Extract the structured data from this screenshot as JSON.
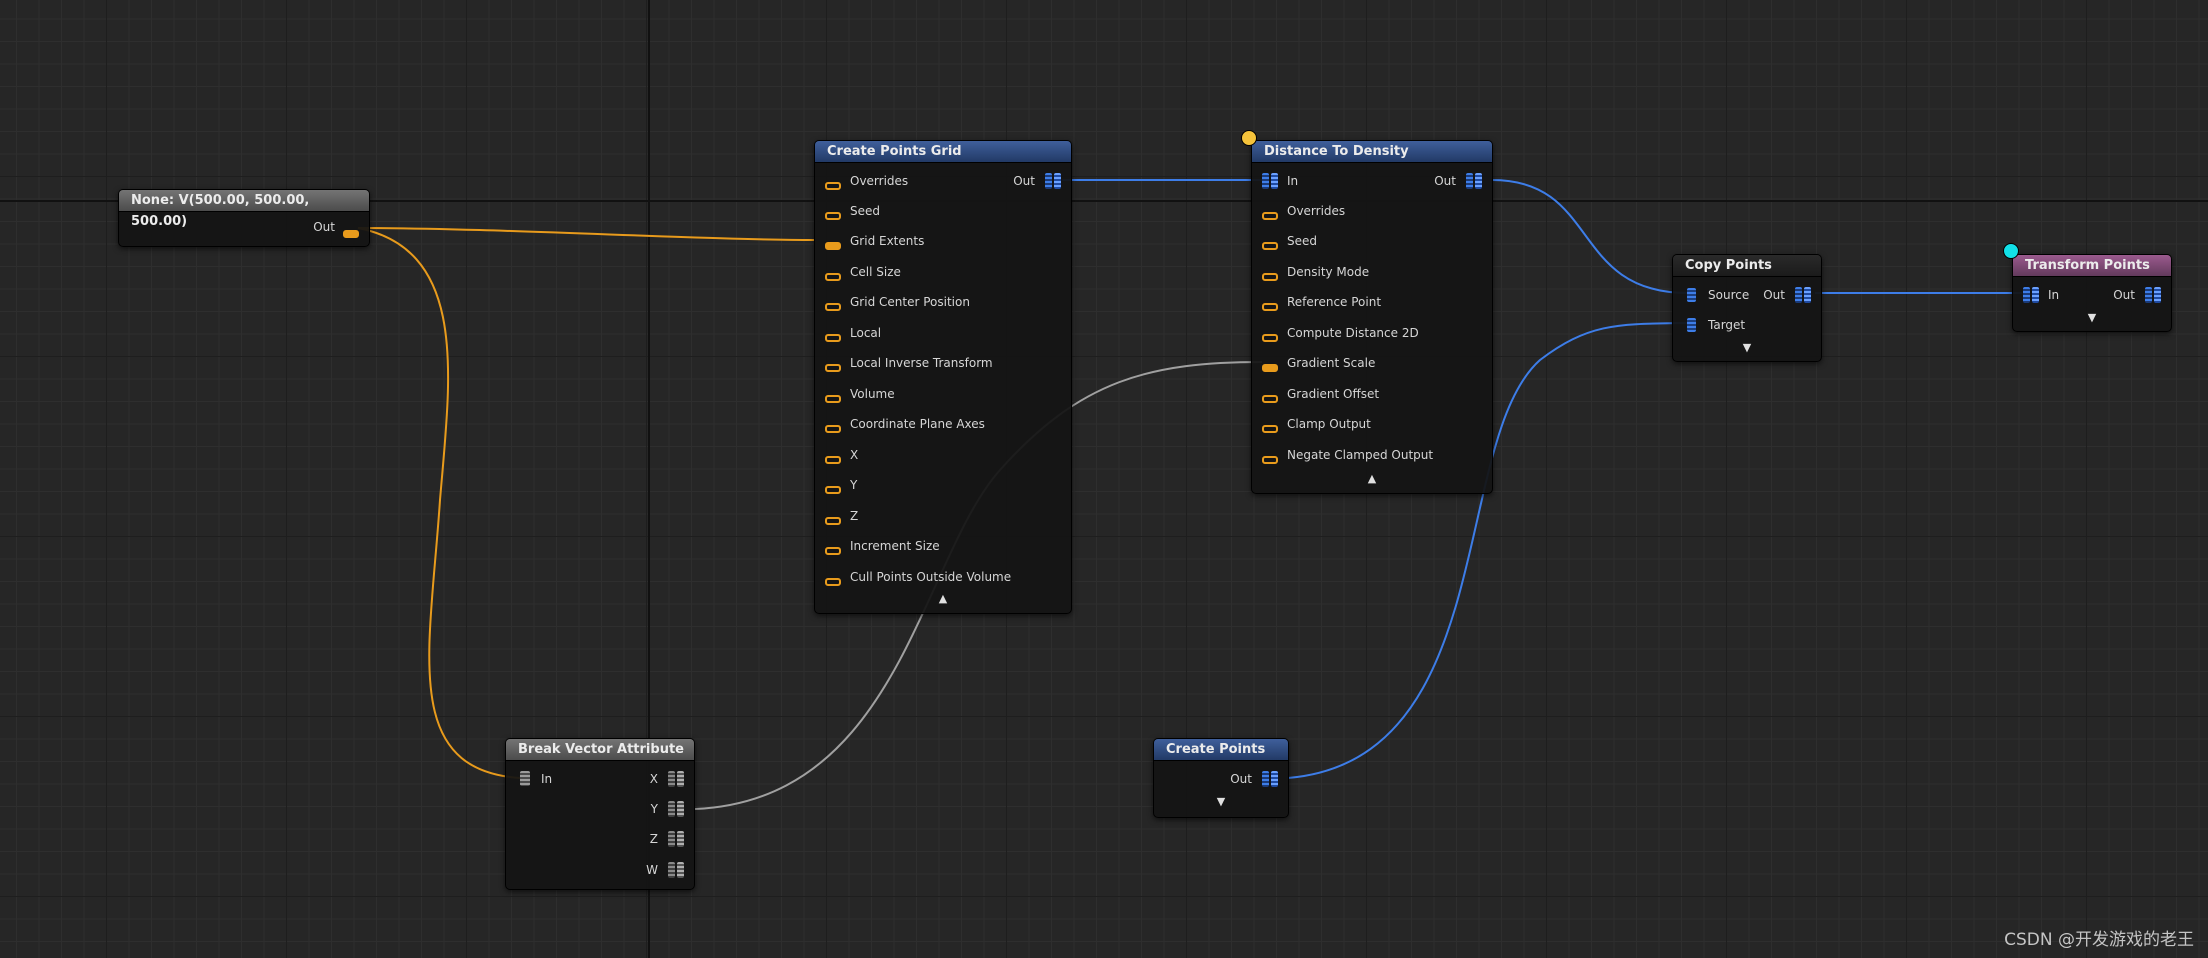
{
  "nodes": {
    "constant": {
      "title": "None: V(500.00, 500.00, 500.00)",
      "out_label": "Out"
    },
    "create_points_grid": {
      "title": "Create Points Grid",
      "out_label": "Out",
      "pins": [
        "Overrides",
        "Seed",
        "Grid Extents",
        "Cell Size",
        "Grid Center Position",
        "Local",
        "Local Inverse Transform",
        "Volume",
        "Coordinate Plane Axes",
        "X",
        "Y",
        "Z",
        "Increment Size",
        "Cull Points Outside Volume"
      ],
      "connected_pin": "Grid Extents"
    },
    "distance_to_density": {
      "title": "Distance To Density",
      "in_label": "In",
      "out_label": "Out",
      "pins": [
        "Overrides",
        "Seed",
        "Density Mode",
        "Reference Point",
        "Compute Distance 2D",
        "Gradient Scale",
        "Gradient Offset",
        "Clamp Output",
        "Negate Clamped Output"
      ],
      "connected_pin": "Gradient Scale"
    },
    "copy_points": {
      "title": "Copy Points",
      "source_label": "Source",
      "target_label": "Target",
      "out_label": "Out"
    },
    "transform_points": {
      "title": "Transform Points",
      "in_label": "In",
      "out_label": "Out"
    },
    "break_vector": {
      "title": "Break Vector Attribute",
      "in_label": "In",
      "outputs": [
        "X",
        "Y",
        "Z",
        "W"
      ]
    },
    "create_points": {
      "title": "Create Points",
      "out_label": "Out"
    }
  },
  "icons": {
    "collapse": "▲",
    "expand": "▼"
  },
  "colors": {
    "param_wire": "#e89b1c",
    "point_wire": "#3d7de8",
    "gray_wire": "#a0a0a0",
    "debug_dot_yellow": "#f5c33b",
    "debug_dot_cyan": "#12e0e8"
  },
  "watermark": "CSDN @开发游戏的老王"
}
